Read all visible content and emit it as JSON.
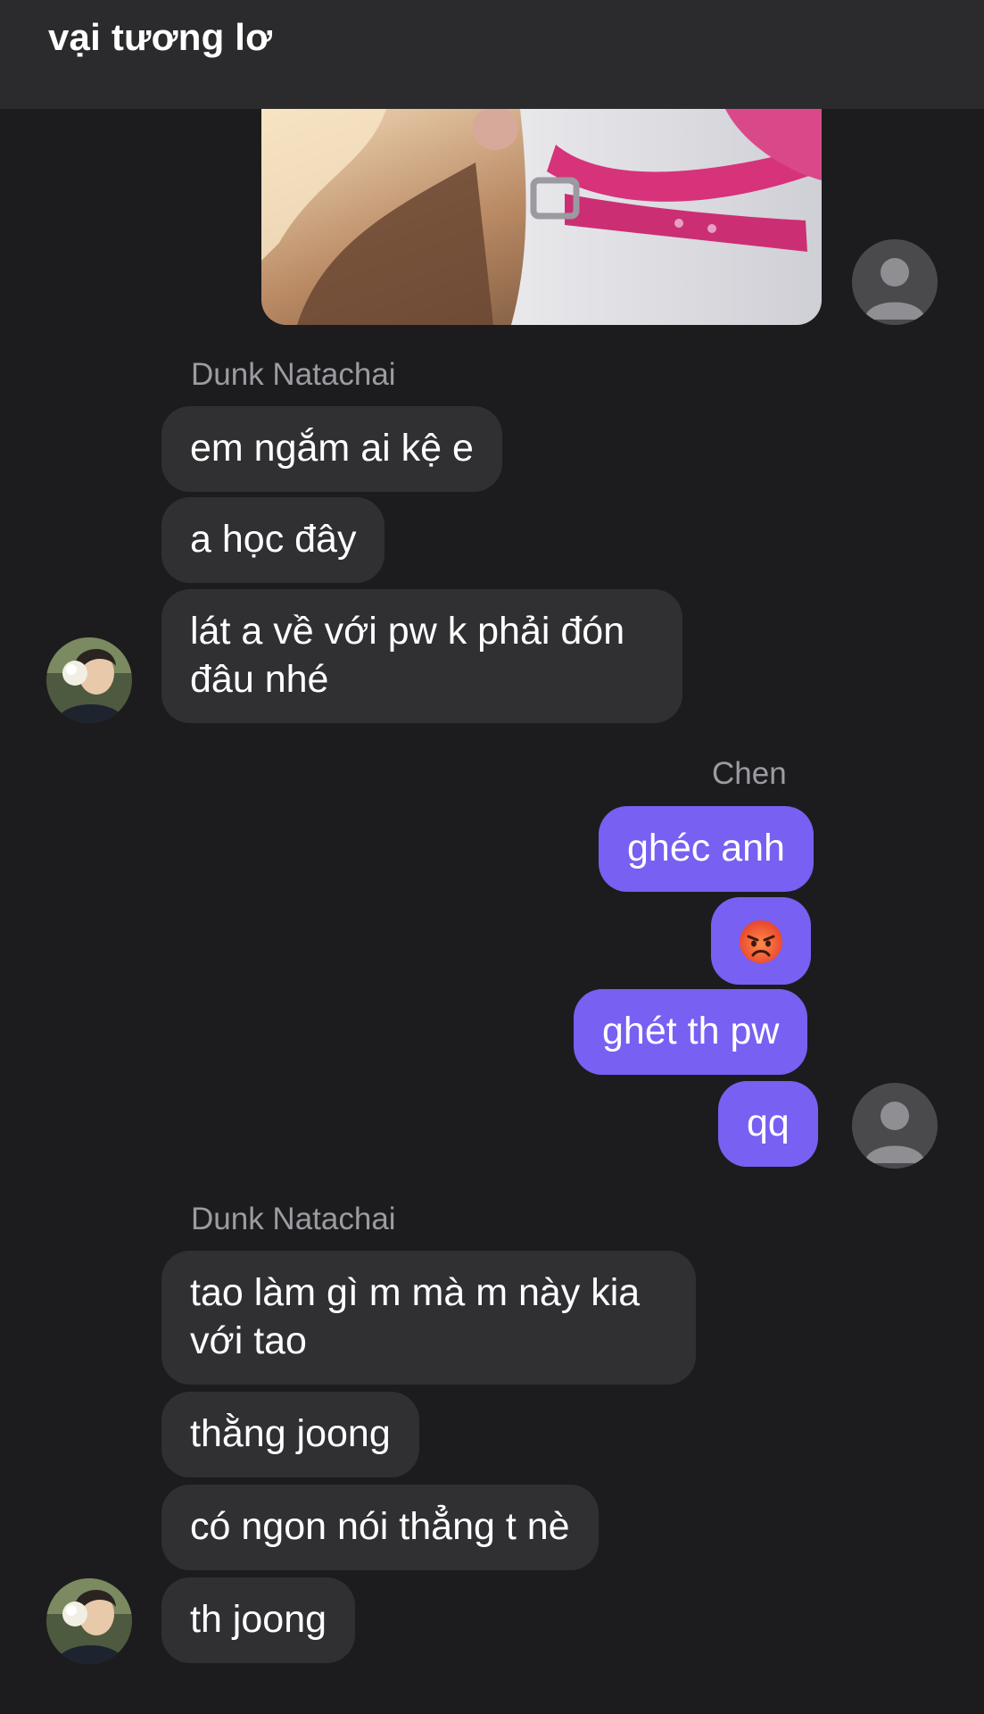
{
  "header": {
    "title": "vại tương lơ"
  },
  "colors": {
    "background": "#1c1c1e",
    "header": "#2b2b2d",
    "incoming_bubble": "#303033",
    "outgoing_bubble": "#7860f2",
    "sender_name": "#9b9ba1"
  },
  "messages": {
    "group1": {
      "sender": "Dunk Natachai",
      "items": [
        "em ngắm ai kệ e",
        "a học đây",
        "lát a về với pw k phải đón đâu nhé"
      ]
    },
    "group2": {
      "sender": "Chen",
      "items": [
        "ghéc anh",
        "angry-face-emoji",
        "ghét th pw",
        "qq"
      ]
    },
    "group3": {
      "sender": "Dunk Natachai",
      "items": [
        "tao làm gì m mà m này kia với tao",
        "thằng joong",
        "có ngon nói thẳng t nè",
        "th joong"
      ]
    }
  },
  "icons": {
    "default_avatar": "person-placeholder-icon",
    "contact_avatar": "profile-photo",
    "emoji": "angry-face-emoji"
  }
}
